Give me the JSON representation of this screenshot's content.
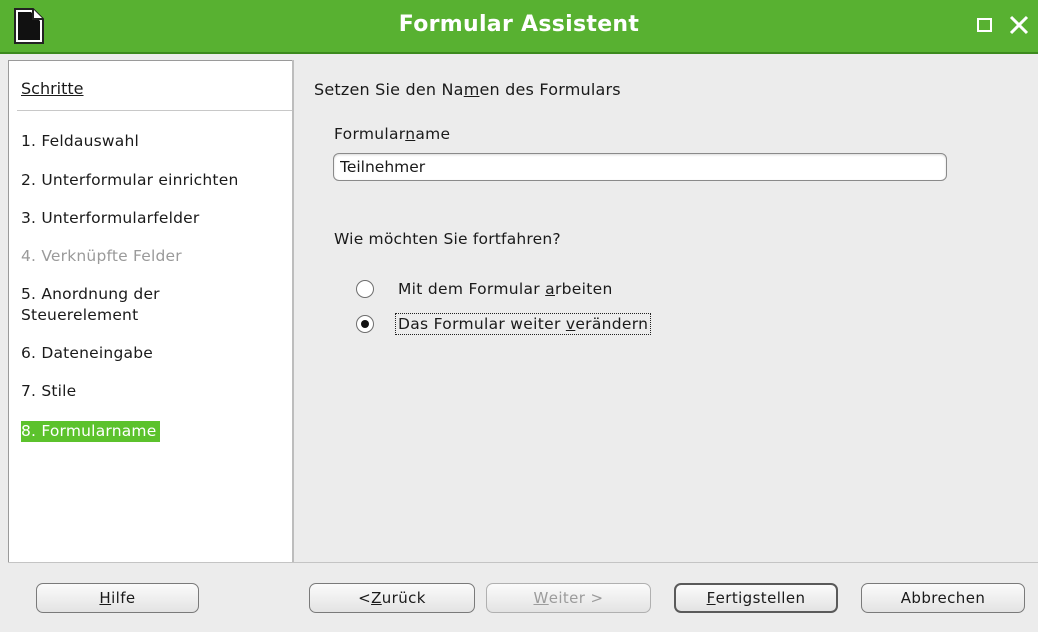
{
  "window": {
    "title": "Formular Assistent"
  },
  "steps": {
    "heading": "Schritte",
    "items": [
      {
        "label": "1. Feldauswahl",
        "state": "normal"
      },
      {
        "label": "2. Unterformular einrichten",
        "state": "normal"
      },
      {
        "label": "3. Unterformularfelder",
        "state": "normal"
      },
      {
        "label": "4. Verknüpfte Felder",
        "state": "disabled"
      },
      {
        "label": "5. Anordnung der",
        "label2": "Steuerelement",
        "state": "normal"
      },
      {
        "label": "6. Dateneingabe",
        "state": "normal"
      },
      {
        "label": "7. Stile",
        "state": "normal"
      },
      {
        "label": "8. Formularname",
        "state": "active"
      }
    ]
  },
  "main": {
    "title_pre": "Setzen Sie den Na",
    "title_mnemonic": "m",
    "title_post": "en des Formulars",
    "name_label_pre": "Formular",
    "name_label_mnemonic": "n",
    "name_label_post": "ame",
    "name_value": "Teilnehmer",
    "question": "Wie möchten Sie fortfahren?",
    "options": [
      {
        "pre": "Mit dem Formular ",
        "mnemonic": "a",
        "post": "rbeiten",
        "checked": false
      },
      {
        "pre": "Das Formular weiter ",
        "mnemonic": "v",
        "post": "erändern",
        "checked": true
      }
    ]
  },
  "buttons": {
    "help": {
      "mnemonic": "H",
      "rest": "ilfe"
    },
    "back": {
      "pre": "< ",
      "mnemonic": "Z",
      "rest": "urück"
    },
    "next": {
      "mnemonic": "W",
      "rest": "eiter >"
    },
    "finish": {
      "mnemonic": "F",
      "rest": "ertigstellen"
    },
    "cancel": {
      "label": "Abbrechen"
    }
  },
  "colors": {
    "titlebar": "#58b131",
    "active_step": "#5cc22c"
  }
}
